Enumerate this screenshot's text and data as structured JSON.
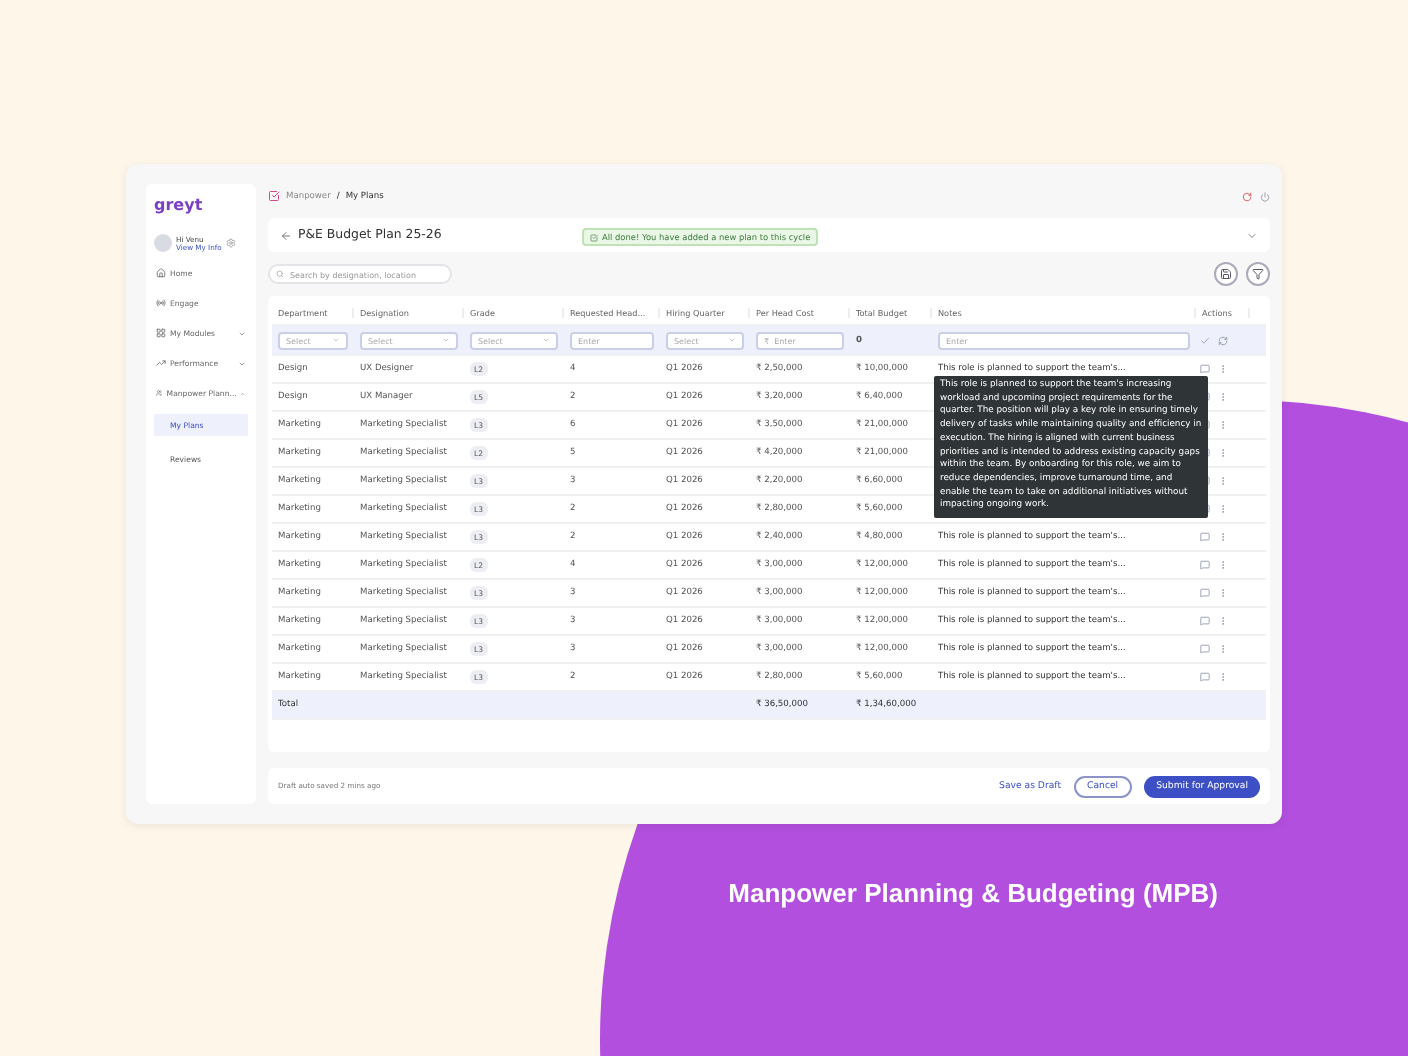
{
  "sidebar": {
    "logo": "greyt",
    "user": {
      "name": "Hi Venu",
      "link": "View My Info"
    },
    "items": [
      {
        "label": "Home",
        "selected": false
      },
      {
        "label": "Engage",
        "selected": false
      },
      {
        "label": "My Modules",
        "selected": false,
        "expanded": false
      },
      {
        "label": "Performance",
        "selected": false,
        "expanded": false
      },
      {
        "label": "Manpower Plann...",
        "selected": false,
        "expanded": true,
        "children": [
          {
            "label": "My Plans",
            "selected": true
          },
          {
            "label": "Reviews",
            "selected": false
          }
        ]
      }
    ]
  },
  "breadcrumb": [
    "Manpower",
    "My Plans"
  ],
  "breadcrumb_separator": "/",
  "toast": "All done! You have added a new plan to this cycle",
  "plan_title": "P&E Budget Plan 25-26",
  "search": {
    "placeholder": "Search by designation, location"
  },
  "table": {
    "columns": [
      "Department",
      "Designation",
      "Grade",
      "Requested Head...",
      "Hiring Quarter",
      "Per Head Cost",
      "Total Budget",
      "Notes",
      "Actions"
    ],
    "filters": [
      {
        "kind": "select",
        "placeholder": "Select"
      },
      {
        "kind": "select",
        "placeholder": "Select"
      },
      {
        "kind": "select",
        "placeholder": "Select"
      },
      {
        "kind": "input",
        "placeholder": "Enter"
      },
      {
        "kind": "select",
        "placeholder": "Select"
      },
      {
        "kind": "input",
        "placeholder": "₹  Enter"
      },
      {
        "kind": "value",
        "value": "0"
      },
      {
        "kind": "input",
        "placeholder": "Enter"
      }
    ],
    "rows": [
      {
        "department": "Design",
        "designation": "UX Designer",
        "grade": "L2",
        "heads": "4",
        "quarter": "Q1 2026",
        "per_head": "₹ 2,50,000",
        "total": "₹ 10,00,000",
        "notes": "This role is planned to support the team's..."
      },
      {
        "department": "Design",
        "designation": "UX Manager",
        "grade": "L5",
        "heads": "2",
        "quarter": "Q1 2026",
        "per_head": "₹ 3,20,000",
        "total": "₹ 6,40,000"
      },
      {
        "department": "Marketing",
        "designation": "Marketing Specialist",
        "grade": "L3",
        "heads": "6",
        "quarter": "Q1 2026",
        "per_head": "₹ 3,50,000",
        "total": "₹ 21,00,000"
      },
      {
        "department": "Marketing",
        "designation": "Marketing Specialist",
        "grade": "L2",
        "heads": "5",
        "quarter": "Q1 2026",
        "per_head": "₹ 4,20,000",
        "total": "₹ 21,00,000"
      },
      {
        "department": "Marketing",
        "designation": "Marketing Specialist",
        "grade": "L3",
        "heads": "3",
        "quarter": "Q1 2026",
        "per_head": "₹ 2,20,000",
        "total": "₹ 6,60,000"
      },
      {
        "department": "Marketing",
        "designation": "Marketing Specialist",
        "grade": "L3",
        "heads": "2",
        "quarter": "Q1 2026",
        "per_head": "₹ 2,80,000",
        "total": "₹ 5,60,000"
      },
      {
        "department": "Marketing",
        "designation": "Marketing Specialist",
        "grade": "L3",
        "heads": "2",
        "quarter": "Q1 2026",
        "per_head": "₹ 2,40,000",
        "total": "₹ 4,80,000",
        "notes": "This role is planned to support the team's..."
      },
      {
        "department": "Marketing",
        "designation": "Marketing Specialist",
        "grade": "L2",
        "heads": "4",
        "quarter": "Q1 2026",
        "per_head": "₹ 3,00,000",
        "total": "₹ 12,00,000",
        "notes": "This role is planned to support the team's..."
      },
      {
        "department": "Marketing",
        "designation": "Marketing Specialist",
        "grade": "L3",
        "heads": "3",
        "quarter": "Q1 2026",
        "per_head": "₹ 3,00,000",
        "total": "₹ 12,00,000",
        "notes": "This role is planned to support the team's..."
      },
      {
        "department": "Marketing",
        "designation": "Marketing Specialist",
        "grade": "L3",
        "heads": "3",
        "quarter": "Q1 2026",
        "per_head": "₹ 3,00,000",
        "total": "₹ 12,00,000",
        "notes": "This role is planned to support the team's..."
      },
      {
        "department": "Marketing",
        "designation": "Marketing Specialist",
        "grade": "L3",
        "heads": "3",
        "quarter": "Q1 2026",
        "per_head": "₹ 3,00,000",
        "total": "₹ 12,00,000",
        "notes": "This role is planned to support the team's..."
      },
      {
        "department": "Marketing",
        "designation": "Marketing Specialist",
        "grade": "L3",
        "heads": "2",
        "quarter": "Q1 2026",
        "per_head": "₹ 2,80,000",
        "total": "₹ 5,60,000",
        "notes": "This role is planned to support the team's..."
      }
    ],
    "total": {
      "label": "Total",
      "per_head": "₹ 36,50,000",
      "total": "₹ 1,34,60,000"
    },
    "tooltip": "This role is planned to support the team's increasing workload and upcoming project requirements for the quarter. The position will play a key role in ensuring timely delivery of tasks while maintaining quality and efficiency in execution. The hiring is aligned with current business priorities and is intended to address existing capacity gaps within the team. By onboarding for this role, we aim to reduce dependencies, improve turnaround time, and enable the team to take on additional initiatives without impacting ongoing work."
  },
  "footer": {
    "status": "Draft auto saved 2 mins ago",
    "buttons": [
      {
        "label": "Save as Draft",
        "kind": "text"
      },
      {
        "label": "Cancel",
        "kind": "outline"
      },
      {
        "label": "Submit for Approval",
        "kind": "primary"
      }
    ]
  },
  "caption": "Manpower Planning & Budgeting (MPB)"
}
